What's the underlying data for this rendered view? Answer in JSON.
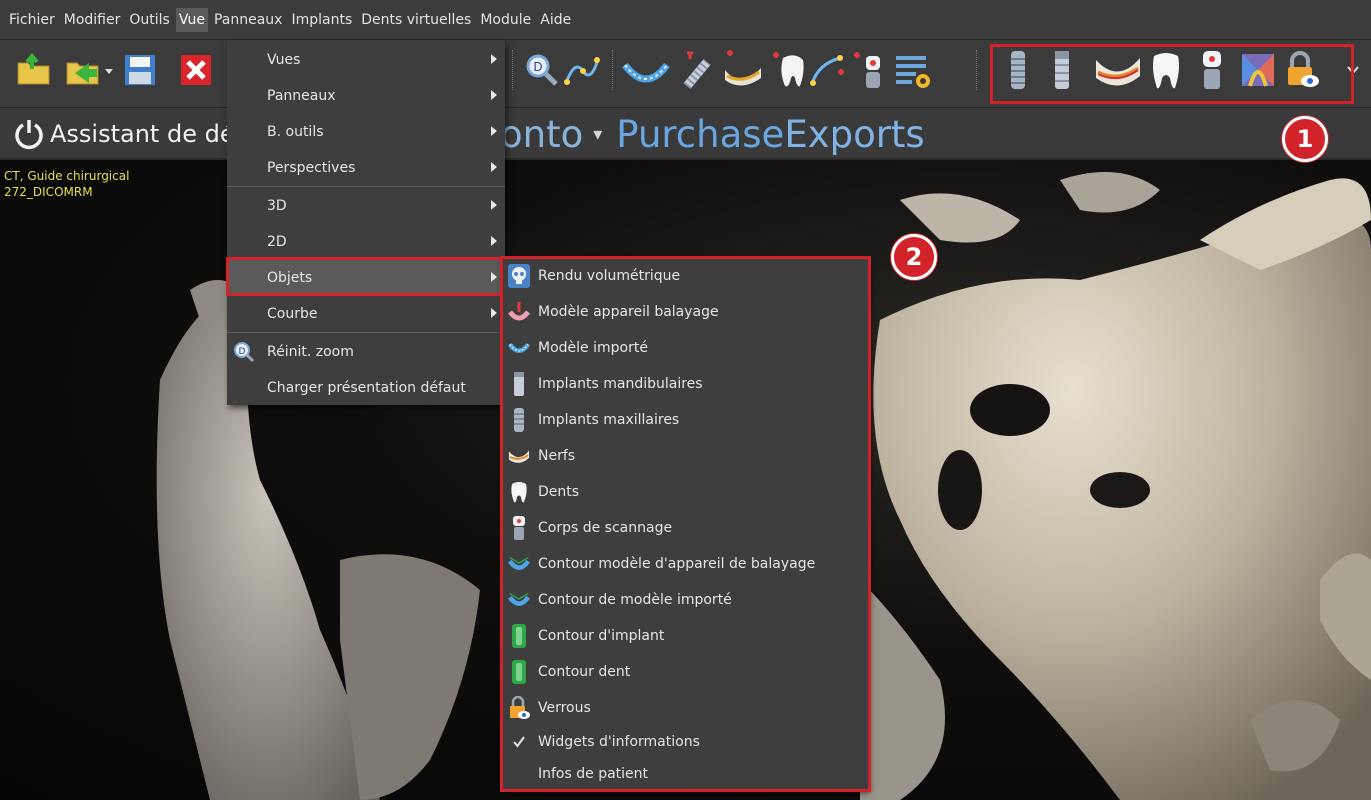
{
  "menubar": {
    "items": [
      "Fichier",
      "Modifier",
      "Outils",
      "Vue",
      "Panneaux",
      "Implants",
      "Dents virtuelles",
      "Module",
      "Aide"
    ],
    "active": "Vue"
  },
  "wizard": {
    "label": "Assistant de dé",
    "brand_fragment": "onto",
    "brand_part1": "Purchase",
    "brand_part2": "Exports"
  },
  "viewport": {
    "line1": "CT, Guide chirurgical",
    "line2": "272_DICOMRM"
  },
  "vue_menu": {
    "items": [
      {
        "label": "Vues",
        "submenu": true
      },
      {
        "label": "Panneaux",
        "submenu": true
      },
      {
        "label": "B. outils",
        "submenu": true
      },
      {
        "label": "Perspectives",
        "submenu": true
      },
      {
        "label": "3D",
        "submenu": true
      },
      {
        "label": "2D",
        "submenu": true
      },
      {
        "label": "Objets",
        "submenu": true,
        "highlighted": true
      },
      {
        "label": "Courbe",
        "submenu": true
      },
      {
        "label": "Réinit. zoom",
        "icon": "zoom-reset-icon"
      },
      {
        "label": "Charger présentation défaut"
      }
    ]
  },
  "objets_menu": {
    "items": [
      {
        "label": "Rendu volumétrique",
        "icon": "skull-icon"
      },
      {
        "label": "Modèle appareil balayage",
        "icon": "scan-appliance-icon"
      },
      {
        "label": "Modèle importé",
        "icon": "imported-model-icon"
      },
      {
        "label": "Implants mandibulaires",
        "icon": "mandibular-implant-icon"
      },
      {
        "label": "Implants maxillaires",
        "icon": "maxillary-implant-icon"
      },
      {
        "label": "Nerfs",
        "icon": "nerve-icon"
      },
      {
        "label": "Dents",
        "icon": "tooth-icon"
      },
      {
        "label": "Corps de scannage",
        "icon": "scan-body-icon"
      },
      {
        "label": "Contour modèle d'appareil de balayage",
        "icon": "scan-appliance-contour-icon"
      },
      {
        "label": "Contour de modèle importé",
        "icon": "imported-model-contour-icon"
      },
      {
        "label": "Contour d'implant",
        "icon": "implant-contour-icon"
      },
      {
        "label": "Contour dent",
        "icon": "tooth-contour-icon"
      },
      {
        "label": "Verrous",
        "icon": "lock-eye-icon"
      },
      {
        "label": "Widgets d'informations",
        "icon": "checkmark-icon",
        "checked": true
      },
      {
        "label": "Infos de patient"
      }
    ]
  },
  "callouts": [
    "1",
    "2"
  ],
  "colors": {
    "highlight_red": "#d2232a",
    "menu_bg": "#3e3e3e",
    "overlay_text": "#e3e050",
    "brand_blue": "#6aa6e2"
  }
}
